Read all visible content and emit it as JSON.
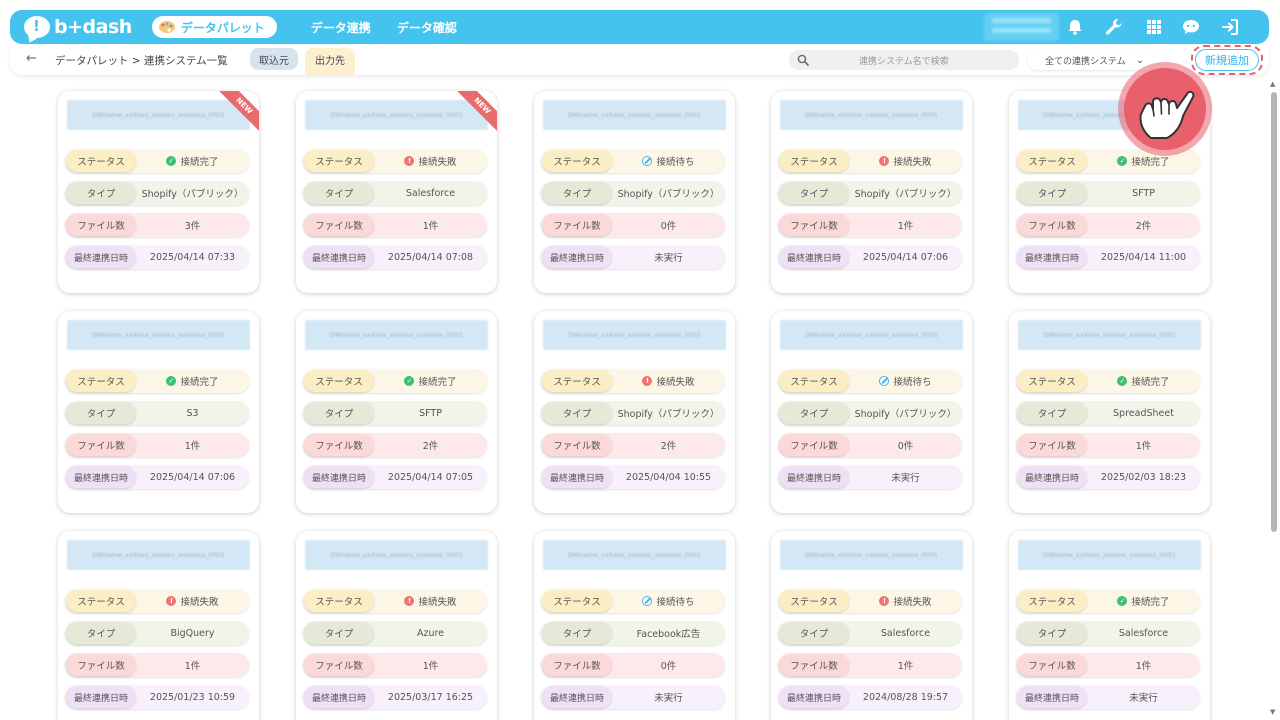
{
  "header": {
    "logo_text": "b+dash",
    "palette_label": "データパレット",
    "nav": [
      "データ連携",
      "データ確認"
    ]
  },
  "subheader": {
    "back_icon": "←",
    "breadcrumb": "データパレット > 連携システム一覧",
    "tab_import": "取込元",
    "tab_export": "出力先",
    "search_placeholder": "連携システム名で検索",
    "filter_value": "全ての連携システム",
    "add_button": "新規追加"
  },
  "labels": {
    "status": "ステータス",
    "type": "タイプ",
    "files": "ファイル数",
    "last": "最終連携日時"
  },
  "card_title_placeholder": "DWname_xxXxxx_xxxxxx_xxxxxxx_0001",
  "cards": [
    {
      "new": "NEW",
      "status": "接続完了",
      "state": "ok",
      "type": "Shopify（パブリック）",
      "files": "3件",
      "last": "2025/04/14 07:33"
    },
    {
      "new": "NEW",
      "status": "接続失敗",
      "state": "err",
      "type": "Salesforce",
      "files": "1件",
      "last": "2025/04/14 07:08"
    },
    {
      "new": "",
      "status": "接続待ち",
      "state": "wait",
      "type": "Shopify（パブリック）",
      "files": "0件",
      "last": "未実行"
    },
    {
      "new": "",
      "status": "接続失敗",
      "state": "err",
      "type": "Shopify（パブリック）",
      "files": "1件",
      "last": "2025/04/14 07:06"
    },
    {
      "new": "",
      "status": "接続完了",
      "state": "ok",
      "type": "SFTP",
      "files": "2件",
      "last": "2025/04/14 11:00"
    },
    {
      "new": "",
      "status": "接続完了",
      "state": "ok",
      "type": "S3",
      "files": "1件",
      "last": "2025/04/14 07:06"
    },
    {
      "new": "",
      "status": "接続完了",
      "state": "ok",
      "type": "SFTP",
      "files": "2件",
      "last": "2025/04/14 07:05"
    },
    {
      "new": "",
      "status": "接続失敗",
      "state": "err",
      "type": "Shopify（パブリック）",
      "files": "2件",
      "last": "2025/04/04 10:55"
    },
    {
      "new": "",
      "status": "接続待ち",
      "state": "wait",
      "type": "Shopify（パブリック）",
      "files": "0件",
      "last": "未実行"
    },
    {
      "new": "",
      "status": "接続完了",
      "state": "ok",
      "type": "SpreadSheet",
      "files": "1件",
      "last": "2025/02/03 18:23"
    },
    {
      "new": "",
      "status": "接続失敗",
      "state": "err",
      "type": "BigQuery",
      "files": "1件",
      "last": "2025/01/23 10:59"
    },
    {
      "new": "",
      "status": "接続失敗",
      "state": "err",
      "type": "Azure",
      "files": "1件",
      "last": "2025/03/17 16:25"
    },
    {
      "new": "",
      "status": "接続待ち",
      "state": "wait",
      "type": "Facebook広告",
      "files": "0件",
      "last": "未実行"
    },
    {
      "new": "",
      "status": "接続失敗",
      "state": "err",
      "type": "Salesforce",
      "files": "1件",
      "last": "2024/08/28 19:57"
    },
    {
      "new": "",
      "status": "接続完了",
      "state": "ok",
      "type": "Salesforce",
      "files": "1件",
      "last": "未実行"
    }
  ],
  "colors": {
    "brand": "#45c3ef",
    "highlight": "#e8606b",
    "ok": "#3cbf73",
    "error": "#f07272",
    "waiting": "#45b2e6"
  },
  "icons": {
    "header_right": [
      "bell-icon",
      "wrench-icon",
      "grid-icon",
      "chat-bot-icon",
      "logout-icon"
    ],
    "search": "search-icon",
    "pointer": "hand-pointer-icon"
  }
}
